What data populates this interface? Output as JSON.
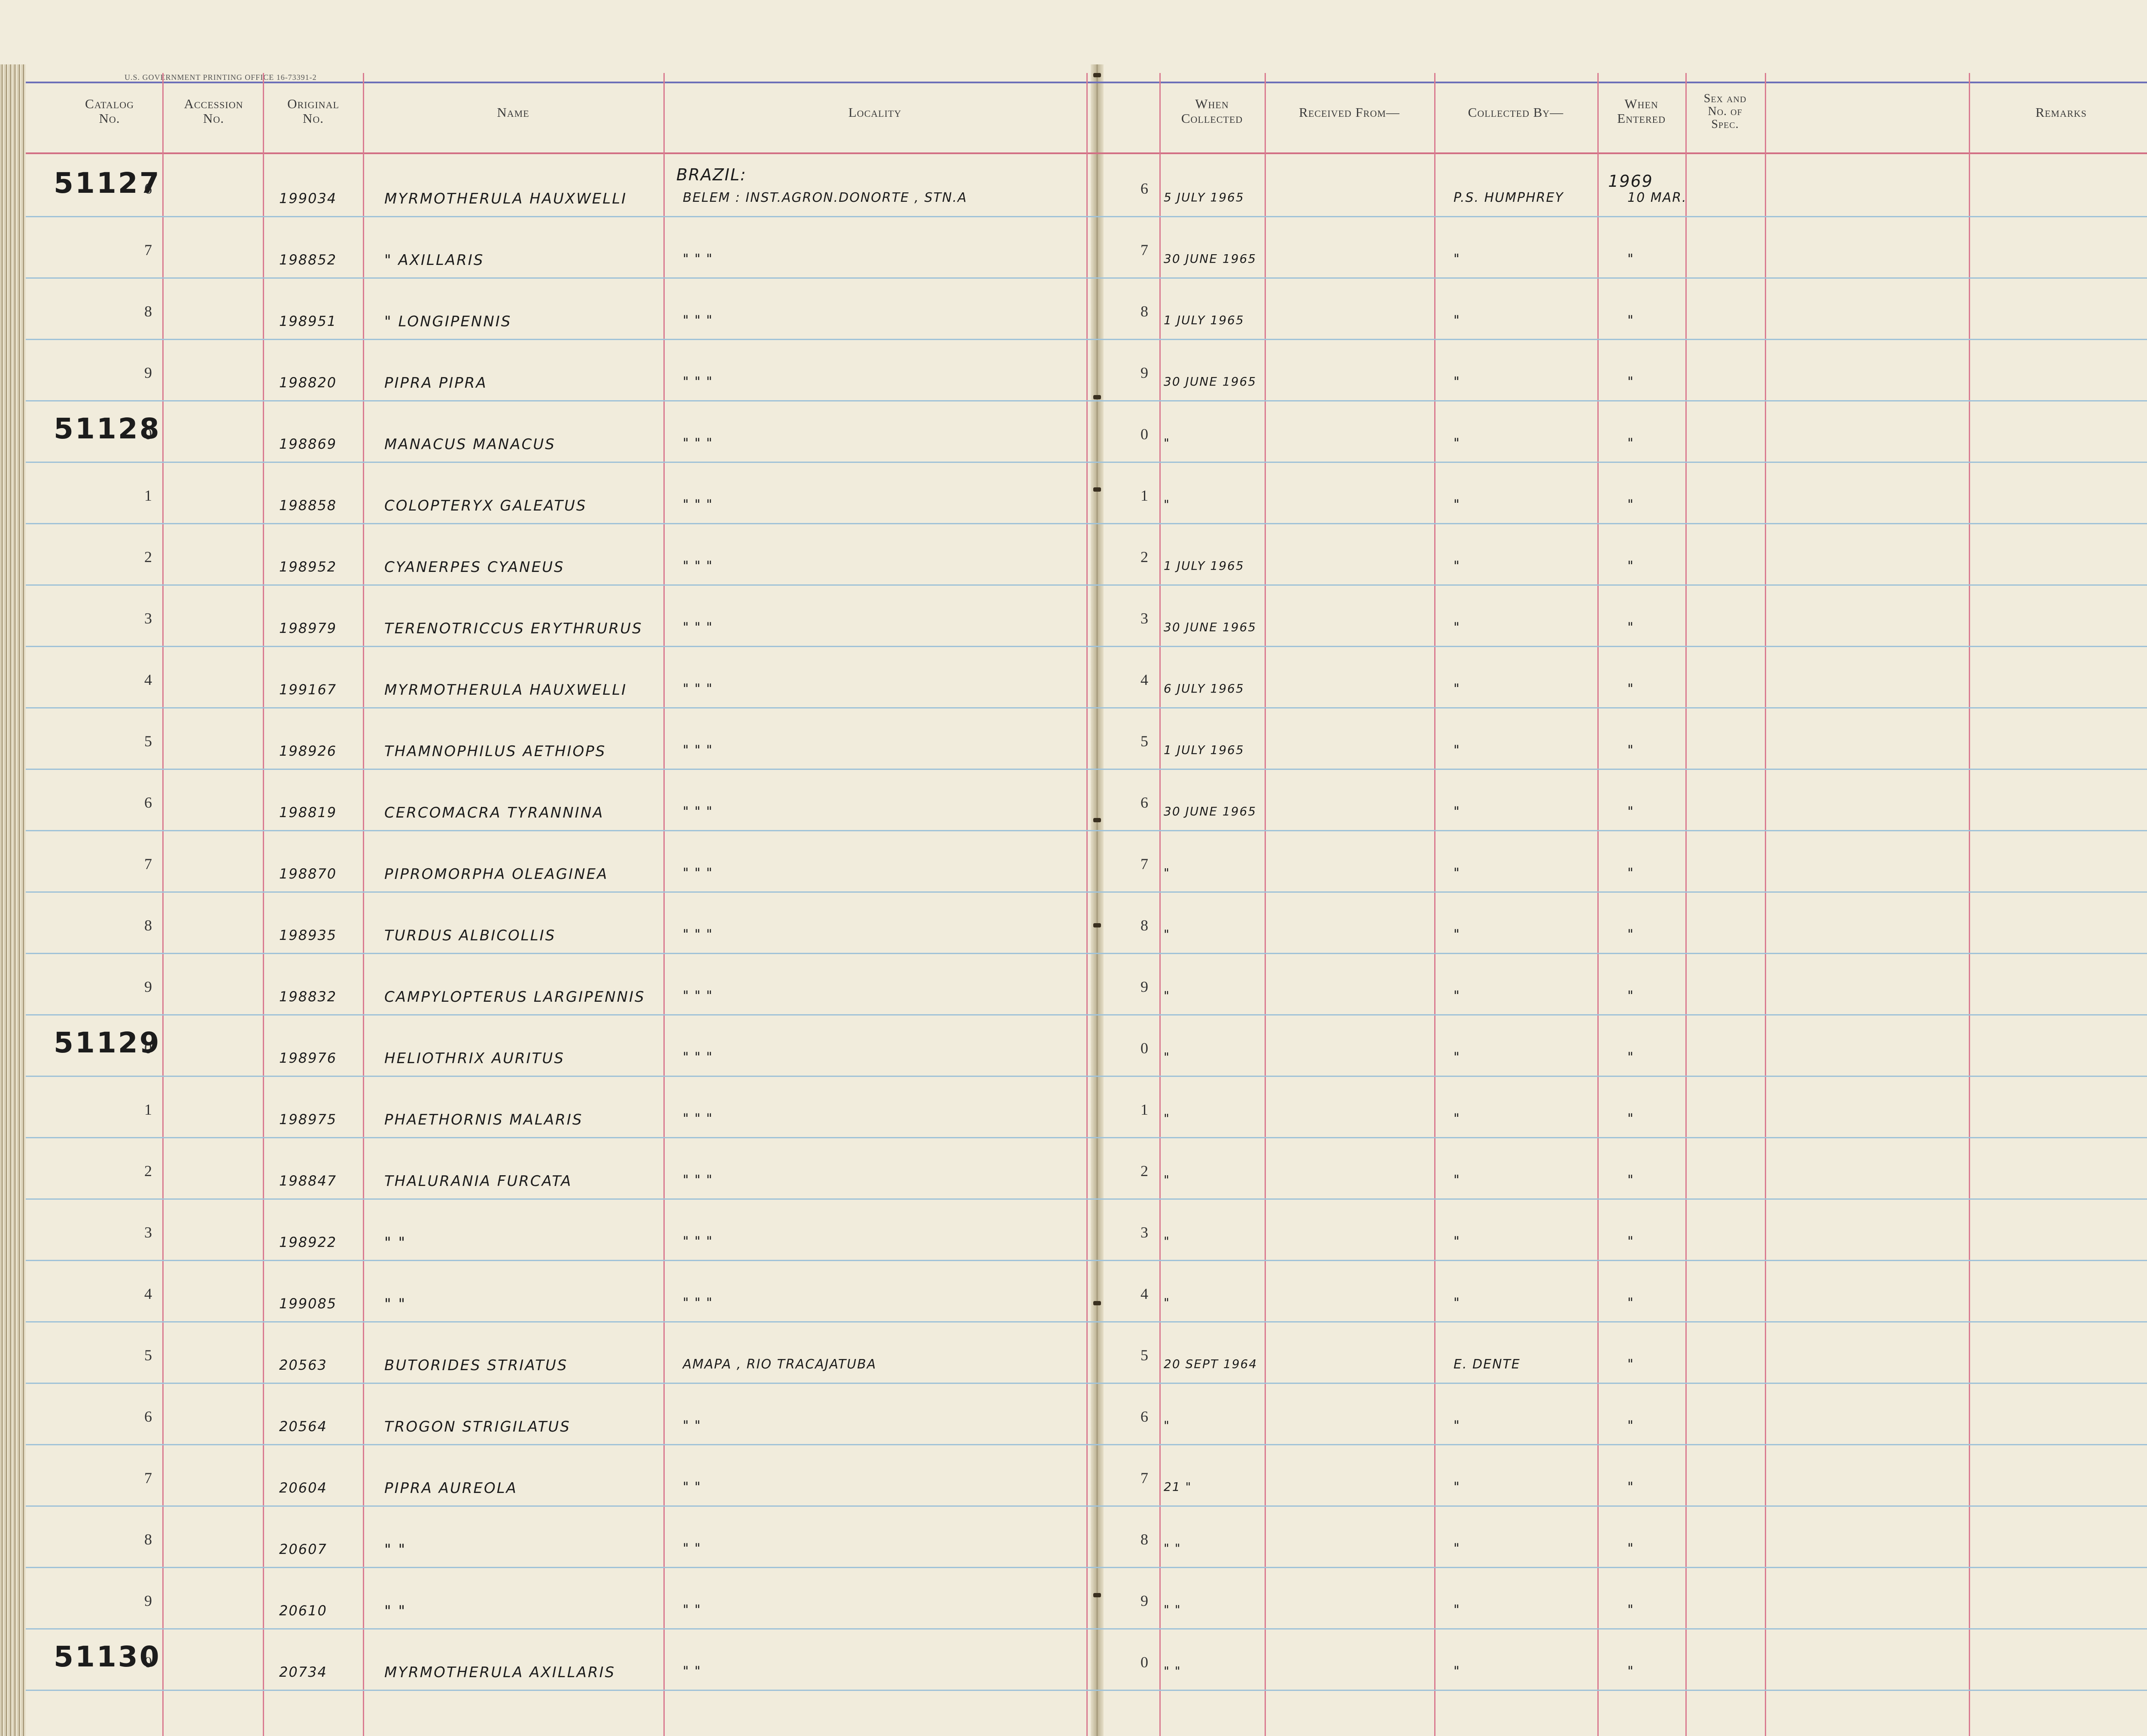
{
  "header_print": "U.S. GOVERNMENT PRINTING OFFICE   16-73391-2",
  "left_headers": {
    "catalog": [
      "Catalog",
      "No."
    ],
    "accession": [
      "Accession",
      "No."
    ],
    "original": [
      "Original",
      "No."
    ],
    "name": "Name",
    "locality": "Locality"
  },
  "right_headers": {
    "when_collected": [
      "When",
      "Collected"
    ],
    "received_from": "Received From—",
    "collected_by": "Collected By—",
    "when_entered": [
      "When",
      "Entered"
    ],
    "sex": [
      "Sex and",
      "No. of",
      "Spec."
    ],
    "remarks": "Remarks"
  },
  "locality_heading": "BRAZIL:",
  "entered_year": "1969",
  "catalog_marks": [
    {
      "label": "51127",
      "row": 0
    },
    {
      "label": "51128",
      "row": 4
    },
    {
      "label": "51129",
      "row": 14
    },
    {
      "label": "51130",
      "row": 24
    }
  ],
  "rows": [
    {
      "d": "6",
      "orig": "199034",
      "name": "Myrmotherula hauxwelli",
      "loc": "Belem : Inst.Agron.doNorte , Stn.A",
      "when": "5 July 1965",
      "by": "P.S. Humphrey",
      "entered": "10 Mar."
    },
    {
      "d": "7",
      "orig": "198852",
      "name": "\"      axillaris",
      "loc": "\"          \"          \"",
      "when": "30 June 1965",
      "by": "\"",
      "entered": "\""
    },
    {
      "d": "8",
      "orig": "198951",
      "name": "\"      longipennis",
      "loc": "\"          \"          \"",
      "when": "1 July 1965",
      "by": "\"",
      "entered": "\""
    },
    {
      "d": "9",
      "orig": "198820",
      "name": "Pipra pipra",
      "loc": "\"          \"          \"",
      "when": "30 June 1965",
      "by": "\"",
      "entered": "\""
    },
    {
      "d": "0",
      "orig": "198869",
      "name": "Manacus manacus",
      "loc": "\"          \"          \"",
      "when": "\"",
      "by": "\"",
      "entered": "\""
    },
    {
      "d": "1",
      "orig": "198858",
      "name": "Colopteryx galeatus",
      "loc": "\"          \"          \"",
      "when": "\"",
      "by": "\"",
      "entered": "\""
    },
    {
      "d": "2",
      "orig": "198952",
      "name": "Cyanerpes cyaneus",
      "loc": "\"          \"          \"",
      "when": "1 July 1965",
      "by": "\"",
      "entered": "\""
    },
    {
      "d": "3",
      "orig": "198979",
      "name": "Terenotriccus erythrurus",
      "loc": "\"          \"          \"",
      "when": "30 June 1965",
      "by": "\"",
      "entered": "\""
    },
    {
      "d": "4",
      "orig": "199167",
      "name": "Myrmotherula hauxwelli",
      "loc": "\"          \"          \"",
      "when": "6 July 1965",
      "by": "\"",
      "entered": "\""
    },
    {
      "d": "5",
      "orig": "198926",
      "name": "Thamnophilus aethiops",
      "loc": "\"          \"          \"",
      "when": "1 July 1965",
      "by": "\"",
      "entered": "\""
    },
    {
      "d": "6",
      "orig": "198819",
      "name": "Cercomacra tyrannina",
      "loc": "\"          \"          \"",
      "when": "30 June 1965",
      "by": "\"",
      "entered": "\""
    },
    {
      "d": "7",
      "orig": "198870",
      "name": "Pipromorpha oleaginea",
      "loc": "\"          \"          \"",
      "when": "\"",
      "by": "\"",
      "entered": "\""
    },
    {
      "d": "8",
      "orig": "198935",
      "name": "Turdus albicollis",
      "loc": "\"          \"          \"",
      "when": "\"",
      "by": "\"",
      "entered": "\""
    },
    {
      "d": "9",
      "orig": "198832",
      "name": "Campylopterus largipennis",
      "loc": "\"          \"          \"",
      "when": "\"",
      "by": "\"",
      "entered": "\""
    },
    {
      "d": "0",
      "orig": "198976",
      "name": "Heliothrix auritus",
      "loc": "\"          \"          \"",
      "when": "\"",
      "by": "\"",
      "entered": "\""
    },
    {
      "d": "1",
      "orig": "198975",
      "name": "Phaethornis malaris",
      "loc": "\"          \"          \"",
      "when": "\"",
      "by": "\"",
      "entered": "\""
    },
    {
      "d": "2",
      "orig": "198847",
      "name": "Thalurania furcata",
      "loc": "\"          \"          \"",
      "when": "\"",
      "by": "\"",
      "entered": "\""
    },
    {
      "d": "3",
      "orig": "198922",
      "name": "\"      \"",
      "loc": "\"          \"          \"",
      "when": "\"",
      "by": "\"",
      "entered": "\""
    },
    {
      "d": "4",
      "orig": "199085",
      "name": "\"      \"",
      "loc": "\"          \"          \"",
      "when": "\"",
      "by": "\"",
      "entered": "\""
    },
    {
      "d": "5",
      "orig": "20563",
      "name": "Butorides striatus",
      "loc": "Amapa , Rio Tracajatuba",
      "when": "20 Sept 1964",
      "by": "E. Dente",
      "entered": "\""
    },
    {
      "d": "6",
      "orig": "20564",
      "name": "Trogon strigilatus",
      "loc": "\"          \"",
      "when": "\"",
      "by": "\"",
      "entered": "\""
    },
    {
      "d": "7",
      "orig": "20604",
      "name": "Pipra aureola",
      "loc": "\"          \"",
      "when": "21  \"",
      "by": "\"",
      "entered": "\""
    },
    {
      "d": "8",
      "orig": "20607",
      "name": "\"      \"",
      "loc": "\"          \"",
      "when": "\"  \"",
      "by": "\"",
      "entered": "\""
    },
    {
      "d": "9",
      "orig": "20610",
      "name": "\"      \"",
      "loc": "\"          \"",
      "when": "\"  \"",
      "by": "\"",
      "entered": "\""
    },
    {
      "d": "0",
      "orig": "20734",
      "name": "Myrmotherula axillaris",
      "loc": "\"          \"",
      "when": "\"  \"",
      "by": "\"",
      "entered": "\""
    }
  ]
}
